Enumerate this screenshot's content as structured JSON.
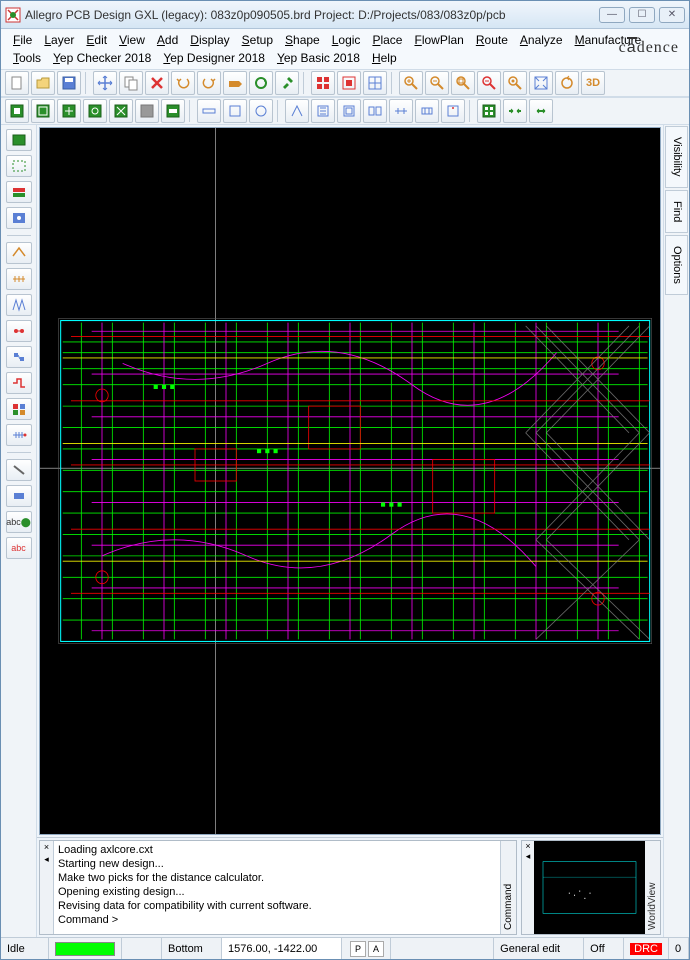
{
  "titlebar": {
    "text": "Allegro PCB Design GXL (legacy): 083z0p090505.brd   Project: D:/Projects/083/083z0p/pcb"
  },
  "menus": [
    "File",
    "Layer",
    "Edit",
    "View",
    "Add",
    "Display",
    "Setup",
    "Shape",
    "Logic",
    "Place",
    "FlowPlan",
    "Route",
    "Analyze",
    "Manufacture",
    "Tools",
    "Yep Checker 2018",
    "Yep Designer 2018",
    "Yep Basic 2018",
    "Help"
  ],
  "brand": "cādence",
  "right_tabs": [
    "Visibility",
    "Find",
    "Options"
  ],
  "command_log": [
    "Loading axlcore.cxt",
    "Starting new design...",
    "Make two picks for the distance calculator.",
    "Opening existing design...",
    "Revising data for compatibility with current software.",
    "Command >"
  ],
  "command_tab": "Command",
  "worldview_tab": "WorldView",
  "status": {
    "idle": "Idle",
    "layer": "Bottom",
    "coords": "1576.00, -1422.00",
    "btn1": "P",
    "btn2": "A",
    "mode": "General edit",
    "drc_state": "Off",
    "drc": "DRC",
    "count": "0"
  },
  "left_labels": {
    "abc1": "abc",
    "abc2": "abc"
  }
}
